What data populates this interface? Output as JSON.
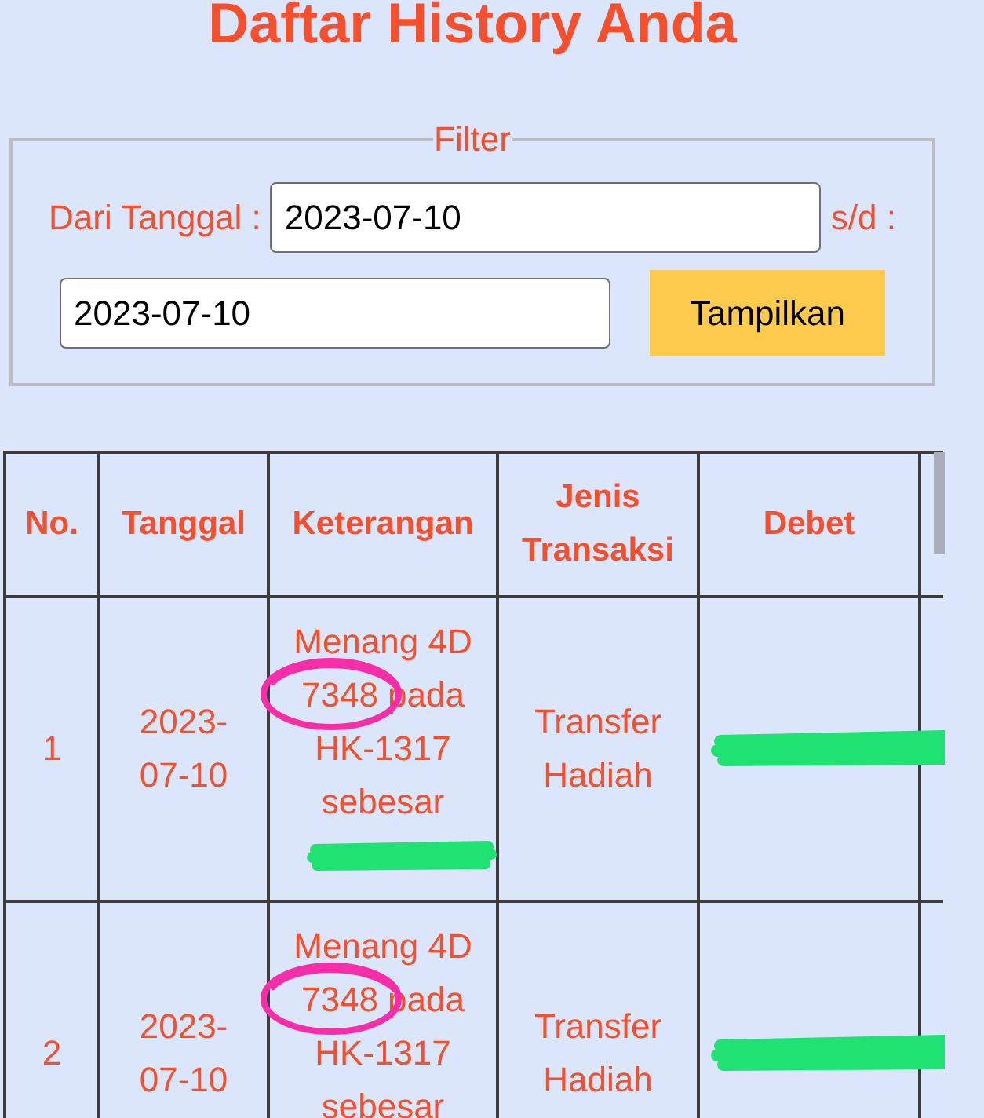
{
  "page": {
    "title": "Daftar History Anda"
  },
  "filter": {
    "legend": "Filter",
    "from_label": "Dari Tanggal :",
    "from_value": "2023-07-10",
    "to_label": "s/d :",
    "to_value": "2023-07-10",
    "button": "Tampilkan"
  },
  "table": {
    "columns": [
      "No.",
      "Tanggal",
      "Keterangan",
      "Jenis Transaksi",
      "Debet"
    ],
    "rows": [
      {
        "no": "1",
        "tanggal": "2023-07-10",
        "keterangan": "Menang 4D 7348 pada HK-1317 sebesar",
        "circled": true,
        "amount_scribbled": true,
        "jenis": "Transfer Hadiah",
        "debet_scribbled": true
      },
      {
        "no": "2",
        "tanggal": "2023-07-10",
        "keterangan": "Menang 4D 7348 pada HK-1317 sebesar",
        "circled": true,
        "jenis": "Transfer Hadiah",
        "debet_scribbled": true
      }
    ]
  }
}
